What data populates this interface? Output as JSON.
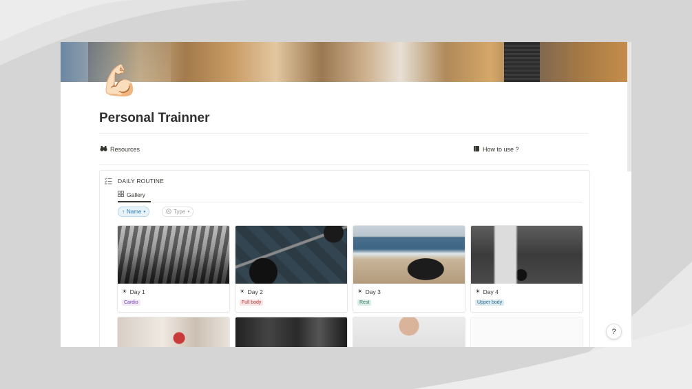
{
  "page": {
    "emoji": "💪🏻",
    "title": "Personal Trainner"
  },
  "links": {
    "resources": {
      "icon": "binoculars-icon",
      "label": "Resources"
    },
    "how_to_use": {
      "icon": "book-icon",
      "label": "How to use ?"
    }
  },
  "database": {
    "title": "DAILY ROUTINE",
    "view_tab": "Gallery",
    "sort_chip": "Name",
    "filter_chip": "Type"
  },
  "cards": [
    {
      "name": "Day 1",
      "tag": "Cardio",
      "tag_bg": "#f3e9f7",
      "tag_color": "#6940a5"
    },
    {
      "name": "Day 2",
      "tag": "Full body",
      "tag_bg": "#fbe4e4",
      "tag_color": "#a83a3a"
    },
    {
      "name": "Day 3",
      "tag": "Rest",
      "tag_bg": "#ddedea",
      "tag_color": "#2b7a54"
    },
    {
      "name": "Day 4",
      "tag": "Upper body",
      "tag_bg": "#ddebf1",
      "tag_color": "#2d6a8c"
    }
  ],
  "help_button": "?"
}
